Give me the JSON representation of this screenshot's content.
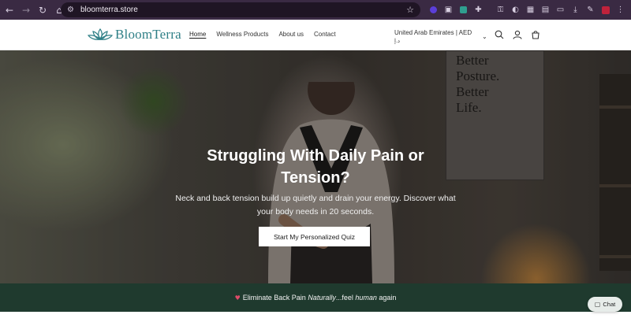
{
  "browser": {
    "url": "bloomterra.store",
    "nav_icons": [
      "back-icon",
      "forward-icon",
      "reload-icon",
      "home-icon"
    ],
    "extension_icons": [
      "extension-purple-icon",
      "extension-camera-icon",
      "extension-teal-icon",
      "extensions-puzzle-icon",
      "key-icon",
      "extension-translate-icon",
      "extension-grid-icon",
      "extension-panel-icon",
      "extension-window-icon",
      "download-icon",
      "extension-edit-icon",
      "profile-avatar-icon"
    ]
  },
  "header": {
    "brand": "BloomTerra",
    "nav": [
      "Home",
      "Wellness Products",
      "About us",
      "Contact"
    ],
    "active_nav": "Home",
    "locale_line1": "United Arab Emirates | AED",
    "locale_line2": "د.إ"
  },
  "hero": {
    "poster_text": "Better\nPosture.\nBetter\nLife.",
    "title": "Struggling With Daily Pain or Tension?",
    "subtitle": "Neck and back tension build up quietly and drain your energy. Discover what your body needs in 20 seconds.",
    "cta": "Start My Personalized Quiz"
  },
  "announcement": {
    "prefix": "Eliminate Back Pain ",
    "em1": "Naturally",
    "mid": "...feel ",
    "em2": "human",
    "suffix": " again"
  },
  "chat": {
    "label": "Chat"
  },
  "colors": {
    "brand": "#2e7f86",
    "band": "#1f3a2e",
    "chrome": "#3a2a43"
  }
}
